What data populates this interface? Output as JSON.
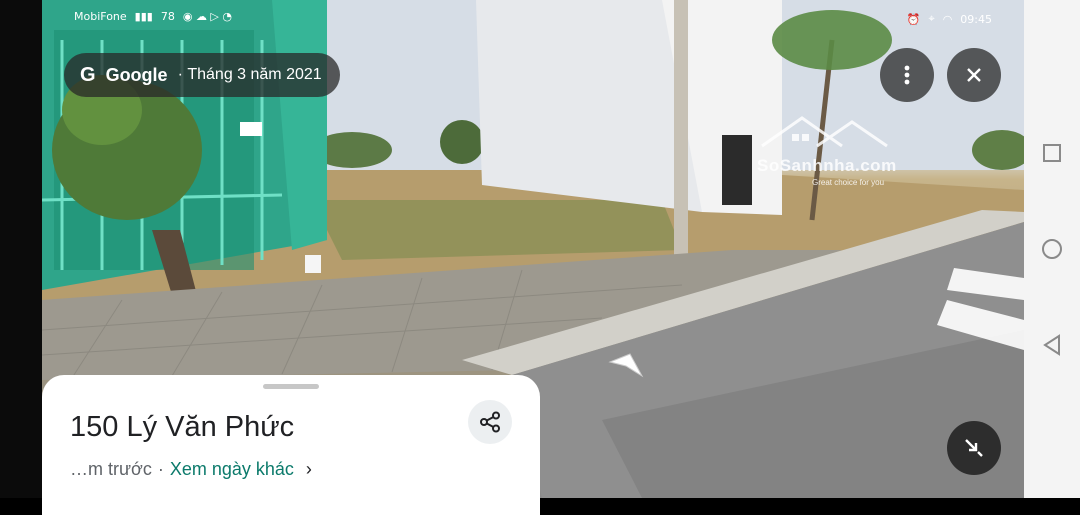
{
  "status_bar": {
    "left_text": "MobiFone",
    "battery": "78",
    "time": "09:45"
  },
  "imagery": {
    "brand": "Google",
    "date": "Tháng 3 năm 2021"
  },
  "watermark": {
    "name": "SoSanhnha.com",
    "tagline": "Great choice for you"
  },
  "sheet": {
    "title": "150 Lý Văn Phức",
    "time_ago": "…m trước",
    "other_dates_link": "Xem ngày khác"
  },
  "icons": {
    "more": "more-vert-icon",
    "close": "close-icon",
    "share": "share-icon",
    "exit": "exit-fullscreen-icon",
    "square": "recent-apps-icon",
    "circle": "home-icon",
    "triangle": "back-icon"
  }
}
